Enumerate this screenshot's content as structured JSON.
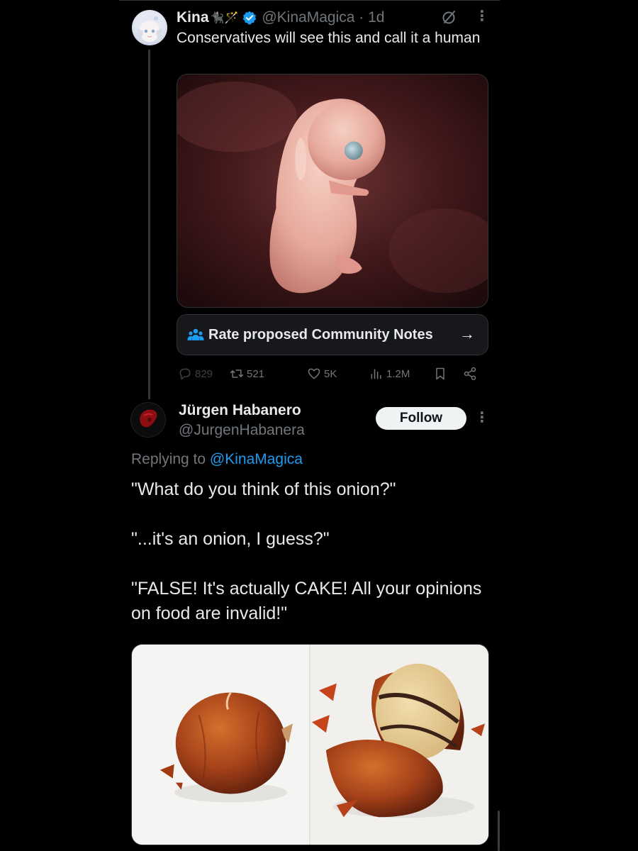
{
  "main_tweet": {
    "author_name": "Kina",
    "name_emoji": "🐈‍⬛🪄",
    "handle": "@KinaMagica",
    "time": "1d",
    "text": "Conservatives will see this and call it a human",
    "image_icon": "fetus-photo",
    "community_notes_label": "Rate proposed Community Notes",
    "community_notes_arrow": "→",
    "stats": {
      "replies": "829",
      "reposts": "521",
      "likes": "5K",
      "views": "1.2M"
    }
  },
  "reply_tweet": {
    "author_name": "Jürgen Habanero",
    "handle": "@JurgenHabanera",
    "follow_label": "Follow",
    "replying_prefix": "Replying to",
    "replying_mention": "@KinaMagica",
    "paragraphs": [
      "\"What do you think of this onion?\"",
      "\"...it's an onion, I guess?\"",
      "\"FALSE! It's actually CAKE! All your opinions on food are invalid!\""
    ],
    "image_icon": "onion-cake-photo"
  },
  "colors": {
    "background": "#000000",
    "text": "#e7e9ea",
    "muted": "#71767b",
    "accent": "#1d9bf0",
    "follow_bg": "#eff3f4"
  }
}
